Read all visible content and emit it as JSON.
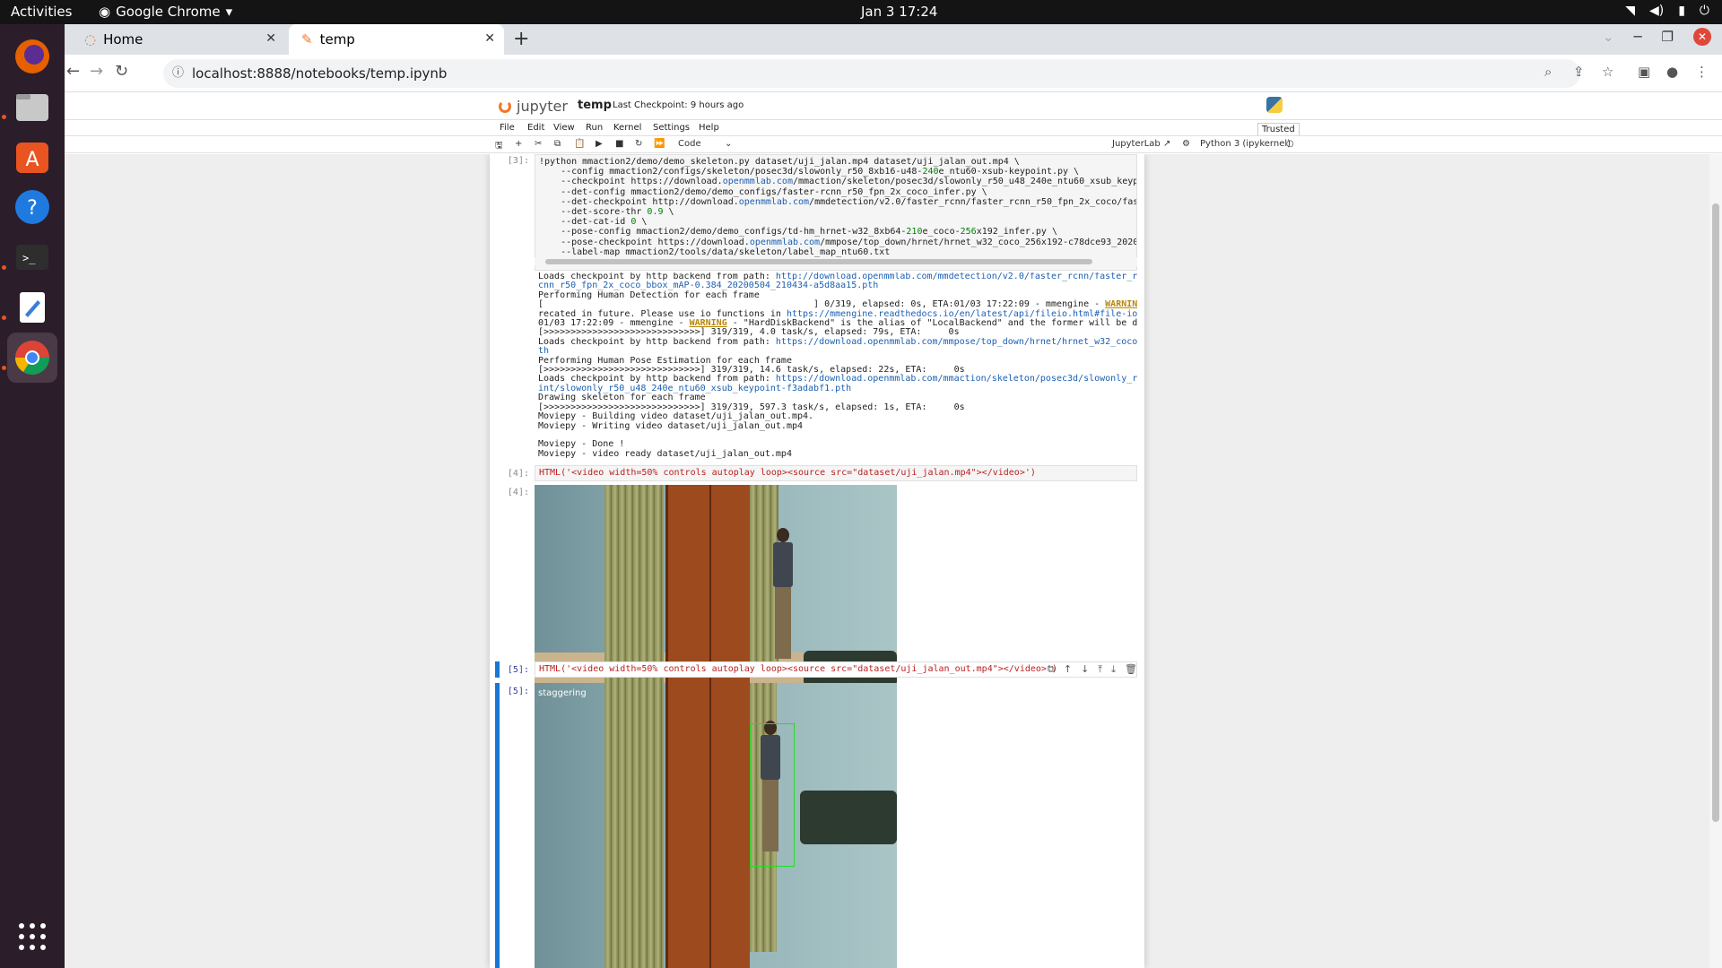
{
  "os": {
    "activities": "Activities",
    "app_name": "Google Chrome",
    "clock": "Jan 3  17:24"
  },
  "browser": {
    "tabs": [
      {
        "label": "Home"
      },
      {
        "label": "temp"
      }
    ],
    "url": "localhost:8888/notebooks/temp.ipynb"
  },
  "jupyter": {
    "logo_text": "jupyter",
    "notebook_title": "temp",
    "checkpoint": "Last Checkpoint: 9 hours ago",
    "menu": [
      "File",
      "Edit",
      "View",
      "Run",
      "Kernel",
      "Settings",
      "Help"
    ],
    "trusted": "Trusted",
    "cell_type": "Code",
    "jupyterlab_link": "JupyterLab",
    "kernel": "Python 3 (ipykernel)"
  },
  "cells": {
    "c3_prompt": "[3]:",
    "c4_in_prompt": "[4]:",
    "c4_out_prompt": "[4]:",
    "c5_in_prompt": "[5]:",
    "c5_out_prompt": "[5]:",
    "c4_code": "HTML('<video width=50% controls autoplay loop><source src=\"dataset/uji_jalan.mp4\"></video>')",
    "c5_code": "HTML('<video width=50% controls autoplay loop><source src=\"dataset/uji_jalan_out.mp4\"></video>')",
    "c5_video_label": "staggering"
  },
  "colors": {
    "jupyter_orange": "#f37726",
    "selection_blue": "#1976d2",
    "bbox_green": "#22dd22",
    "warning": "#b8860b"
  }
}
